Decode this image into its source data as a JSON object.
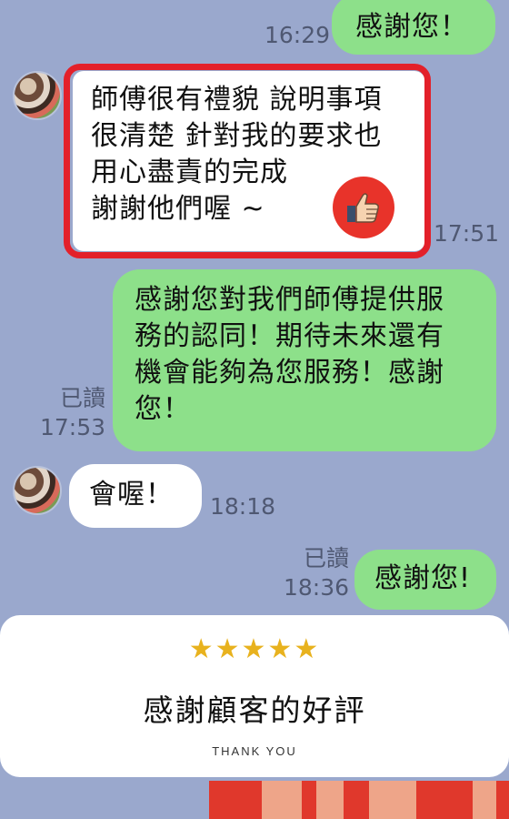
{
  "messages": {
    "m1": {
      "text": "感謝您！",
      "time": "16:29"
    },
    "m2": {
      "lines": [
        "師傅很有禮貌 說明事項",
        "很清楚 針對我的要求也",
        "用心盡責的完成",
        "謝謝他們喔 ~"
      ],
      "time": "17:51"
    },
    "m3": {
      "lines": [
        "感謝您對我們師傅提供服",
        "務的認同！期待未來還有",
        "機會能夠為您服務！感謝",
        "您！"
      ],
      "read": "已讀",
      "time": "17:53"
    },
    "m4": {
      "text": "會喔！",
      "time": "18:18"
    },
    "m5": {
      "text": "感謝您!",
      "read": "已讀",
      "time": "18:36"
    }
  },
  "review_card": {
    "stars": "★★★★★",
    "title": "感謝顧客的好評",
    "subtitle": "THANK YOU"
  },
  "icons": [
    "thumbs-up-icon",
    "avatar"
  ],
  "colors": {
    "background": "#9aa8cd",
    "outgoing_bubble": "#8de08a",
    "incoming_bubble": "#ffffff",
    "highlight": "#e3202a",
    "star": "#e8b21e"
  }
}
